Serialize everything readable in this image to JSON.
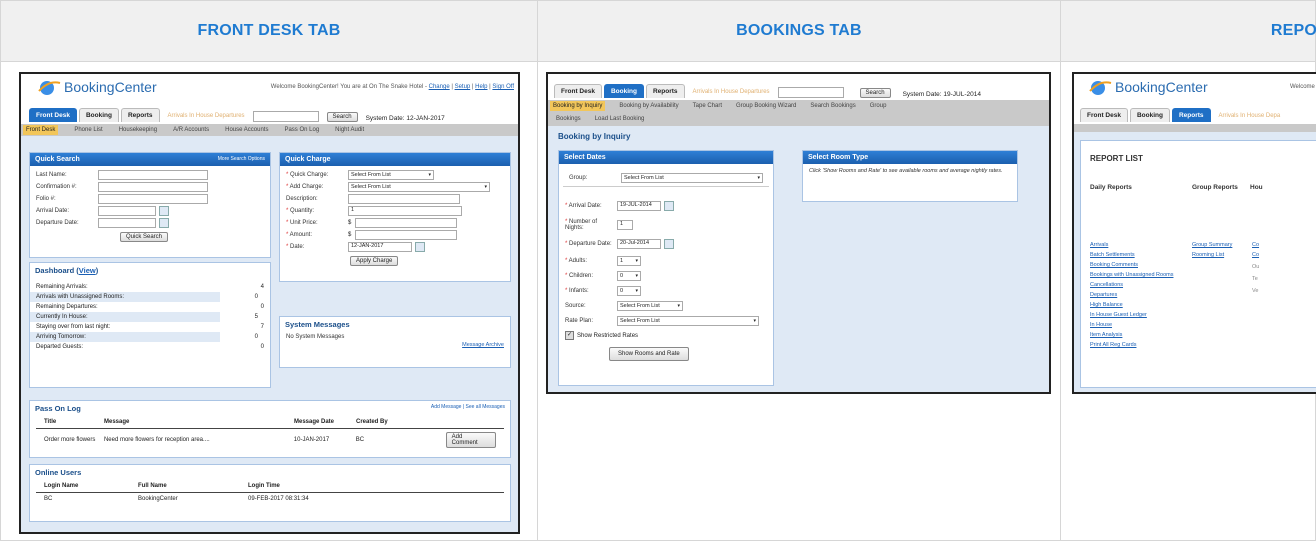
{
  "columns": [
    {
      "header": "FRONT DESK TAB"
    },
    {
      "header": "BOOKINGS TAB"
    },
    {
      "header": "REPO"
    }
  ],
  "brand": {
    "name": "BookingCenter"
  },
  "front": {
    "welcome": "Welcome BookingCenter! You are at On The Snake Hotel -",
    "welcome_links": [
      "Change",
      "Setup",
      "Help",
      "Sign Off"
    ],
    "tabs": [
      "Front Desk",
      "Booking",
      "Reports"
    ],
    "quick_links": "Arrivals In House Departures",
    "search_btn": "Search",
    "system_date": "System Date: 12-JAN-2017",
    "subnav": [
      "Front Desk",
      "Phone List",
      "Housekeeping",
      "A/R Accounts",
      "House Accounts",
      "Pass On Log",
      "Night Audit"
    ],
    "quick_search": {
      "title": "Quick Search",
      "more": "More Search Options",
      "fields": [
        "Last Name:",
        "Confirmation #:",
        "Folio #:",
        "Arrival Date:",
        "Departure Date:"
      ],
      "button": "Quick Search"
    },
    "quick_charge": {
      "title": "Quick Charge",
      "fields": [
        {
          "label": "Quick Charge:",
          "value": "Select From List"
        },
        {
          "label": "Add Charge:",
          "value": "Select From List"
        },
        {
          "label": "Description:",
          "value": ""
        },
        {
          "label": "Quantity:",
          "value": "1"
        },
        {
          "label": "Unit Price:",
          "value": "$"
        },
        {
          "label": "Amount:",
          "value": "$"
        },
        {
          "label": "Date:",
          "value": "12-JAN-2017"
        }
      ],
      "button": "Apply Charge"
    },
    "dashboard": {
      "title": "Dashboard (",
      "title_link": "View",
      "title_end": ")",
      "rows": [
        {
          "label": "Remaining Arrivals:",
          "value": "4"
        },
        {
          "label": "Arrivals with Unassigned Rooms:",
          "value": "0"
        },
        {
          "label": "Remaining Departures:",
          "value": "0"
        },
        {
          "label": "Currently In House:",
          "value": "5"
        },
        {
          "label": "Staying over from last night:",
          "value": "7"
        },
        {
          "label": "Arriving Tomorrow:",
          "value": "0"
        },
        {
          "label": "Departed Guests:",
          "value": "0"
        }
      ]
    },
    "system_messages": {
      "title": "System Messages",
      "text": "No System Messages",
      "link": "Message Archive"
    },
    "pass_on_log": {
      "title": "Pass On Log",
      "links": "Add Message | See all Messages",
      "headers": [
        "Title",
        "Message",
        "Message Date",
        "Created By"
      ],
      "row": [
        "Order more flowers",
        "Need more flowers for reception area....",
        "10-JAN-2017",
        "BC"
      ],
      "button": "Add Comment"
    },
    "online_users": {
      "title": "Online Users",
      "headers": [
        "Login Name",
        "Full Name",
        "Login Time"
      ],
      "row": [
        "BC",
        "BookingCenter",
        "09-FEB-2017 08:31:34"
      ]
    }
  },
  "bookings": {
    "tabs": [
      "Front Desk",
      "Booking",
      "Reports"
    ],
    "quick_links": "Arrivals In House Departures",
    "search_btn": "Search",
    "system_date": "System Date: 19-JUL-2014",
    "subnav": [
      "Booking by Inquiry",
      "Booking by Availability",
      "Tape Chart",
      "Group Booking Wizard",
      "Search Bookings",
      "Group"
    ],
    "subnav2": [
      "Bookings",
      "Load Last Booking"
    ],
    "page_title": "Booking by Inquiry",
    "select_dates": {
      "title": "Select Dates",
      "group_label": "Group:",
      "group_value": "Select From List",
      "arrival_label": "Arrival Date:",
      "arrival_value": "19-JUL-2014",
      "nights_label": "Number of Nights:",
      "nights_value": "1",
      "departure_label": "Departure Date:",
      "departure_value": "20-Jul-2014",
      "adults_label": "Adults:",
      "adults_value": "1",
      "children_label": "Children:",
      "children_value": "0",
      "infants_label": "Infants:",
      "infants_value": "0",
      "source_label": "Source:",
      "source_value": "Select From List",
      "rate_label": "Rate Plan:",
      "rate_value": "Select From List",
      "checkbox": "Show Restricted Rates",
      "button": "Show Rooms and Rate"
    },
    "select_room": {
      "title": "Select Room Type",
      "text": "Click 'Show Rooms and Rate' to see available rooms and average nightly rates."
    }
  },
  "reports": {
    "tabs": [
      "Front Desk",
      "Booking",
      "Reports"
    ],
    "quick_links": "Arrivals In House Depa",
    "welcome": "Welcome",
    "title": "REPORT LIST",
    "headers": [
      "Daily Reports",
      "Group Reports",
      "Hou"
    ],
    "daily": [
      "Arrivals",
      "Batch Settlements",
      "Booking Comments",
      "Bookings with Unassigned Rooms",
      "Cancellations",
      "Departures",
      "High Balance",
      "In House Guest Ledger",
      "In House",
      "Item Analysis",
      "Print All Reg Cards"
    ],
    "group": [
      "Group Summary",
      "Rooming List"
    ],
    "house": [
      "Co",
      "Co",
      "Ou",
      "Te",
      "Ve"
    ]
  }
}
